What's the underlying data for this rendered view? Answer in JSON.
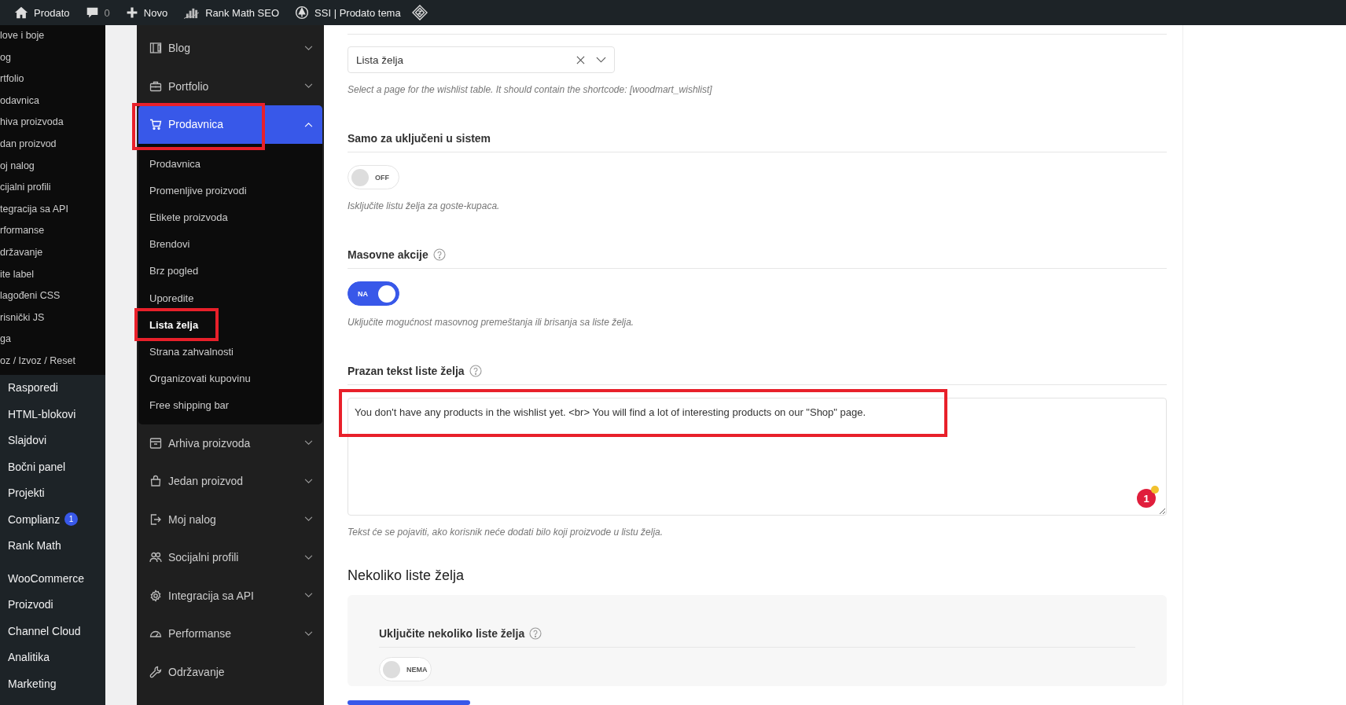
{
  "admin_bar": {
    "items": [
      {
        "label": "Prodato",
        "dim": false
      },
      {
        "label": "0",
        "dim": true
      },
      {
        "label": "Novo",
        "dim": false
      },
      {
        "label": "Rank Math SEO",
        "dim": false
      },
      {
        "label": "SSI | Prodato tema",
        "dim": false
      }
    ]
  },
  "admin_menu": {
    "submenu": [
      "love i boje",
      "og",
      "rtfolio",
      "odavnica",
      "hiva proizvoda",
      "dan proizvod",
      "oj nalog",
      "cijalni profili",
      "tegracija sa API",
      "rformanse",
      "državanje",
      "ite label",
      "lagođeni CSS",
      "risnički JS",
      "ga",
      "oz / Izvoz / Reset"
    ],
    "groups": [
      [
        {
          "label": "Rasporedi"
        },
        {
          "label": "HTML-blokovi"
        },
        {
          "label": "Slajdovi"
        },
        {
          "label": "Bočni panel"
        },
        {
          "label": "Projekti"
        },
        {
          "label": "Complianz",
          "badge": "1"
        },
        {
          "label": "Rank Math"
        }
      ],
      [
        {
          "label": "WooCommerce"
        },
        {
          "label": "Proizvodi"
        },
        {
          "label": "Channel Cloud"
        },
        {
          "label": "Analitika"
        },
        {
          "label": "Marketing"
        }
      ]
    ]
  },
  "settings_nav": [
    {
      "label": "Blog",
      "expandable": true,
      "expanded": false,
      "selected": false
    },
    {
      "label": "Portfolio",
      "expandable": true,
      "expanded": false,
      "selected": false
    },
    {
      "label": "Prodavnica",
      "expandable": true,
      "expanded": true,
      "selected": true,
      "children": [
        {
          "label": "Prodavnica",
          "selected": false
        },
        {
          "label": "Promenljive proizvodi",
          "selected": false
        },
        {
          "label": "Etikete proizvoda",
          "selected": false
        },
        {
          "label": "Brendovi",
          "selected": false
        },
        {
          "label": "Brz pogled",
          "selected": false
        },
        {
          "label": "Uporedite",
          "selected": false
        },
        {
          "label": "Lista želja",
          "selected": true
        },
        {
          "label": "Strana zahvalnosti",
          "selected": false
        },
        {
          "label": "Organizovati kupovinu",
          "selected": false
        },
        {
          "label": "Free shipping bar",
          "selected": false
        }
      ]
    },
    {
      "label": "Arhiva proizvoda",
      "expandable": true,
      "expanded": false,
      "selected": false
    },
    {
      "label": "Jedan proizvod",
      "expandable": true,
      "expanded": false,
      "selected": false
    },
    {
      "label": "Moj nalog",
      "expandable": true,
      "expanded": false,
      "selected": false
    },
    {
      "label": "Socijalni profili",
      "expandable": true,
      "expanded": false,
      "selected": false
    },
    {
      "label": "Integracija sa API",
      "expandable": true,
      "expanded": false,
      "selected": false
    },
    {
      "label": "Performanse",
      "expandable": true,
      "expanded": false,
      "selected": false
    },
    {
      "label": "Održavanje",
      "expandable": false,
      "expanded": false,
      "selected": false
    }
  ],
  "settings": [
    {
      "kind": "select",
      "value": "Lista želja",
      "hint": "Select a page for the wishlist table. It should contain the shortcode: [woodmart_wishlist]"
    },
    {
      "kind": "toggle",
      "label": "Samo za uključeni u sistem",
      "help": false,
      "on": false,
      "state_text": "OFF",
      "hint": "Isključite listu želja za goste-kupaca."
    },
    {
      "kind": "toggle",
      "label": "Masovne akcije",
      "help": true,
      "on": true,
      "state_text": "NA",
      "hint": "Uključite mogućnost masovnog premeštanja ili brisanja sa liste želja."
    },
    {
      "kind": "textarea",
      "label": "Prazan tekst liste želja",
      "help": true,
      "value": "You don't have any products in the wishlist yet. <br> You will find a lot of interesting products on our \"Shop\" page.",
      "badge": "1",
      "hint": "Tekst će se pojaviti, ako korisnik neće dodati bilo koji proizvode u listu želja."
    }
  ],
  "section": {
    "title": "Nekoliko liste želja",
    "settings": [
      {
        "kind": "toggle",
        "label": "Uključite nekoliko liste želja",
        "help": true,
        "on": false,
        "state_text": "NEMA"
      }
    ]
  }
}
